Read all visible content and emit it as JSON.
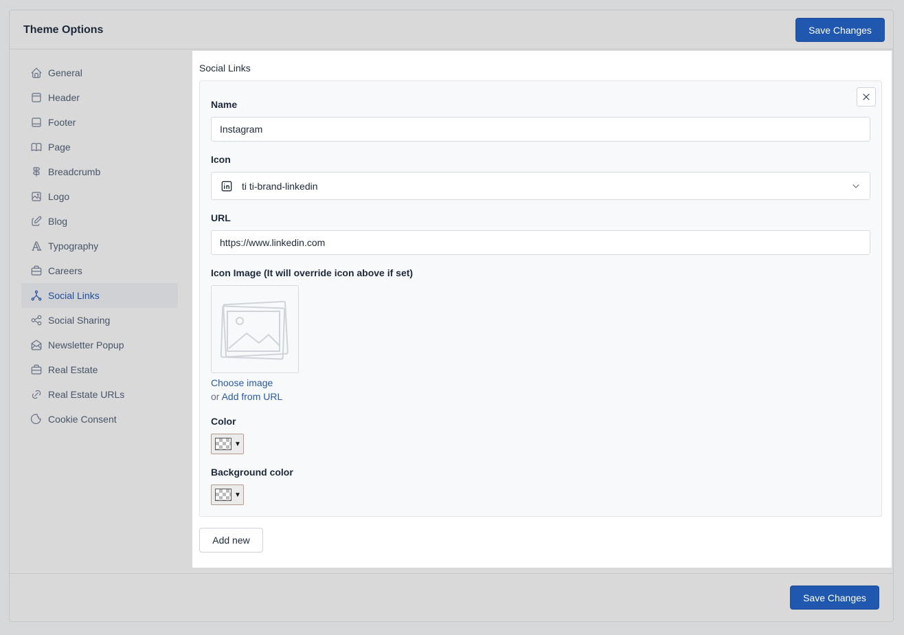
{
  "header": {
    "title": "Theme Options",
    "save_label": "Save Changes"
  },
  "footer": {
    "save_label": "Save Changes"
  },
  "sidebar": {
    "items": [
      {
        "label": "General",
        "icon": "home-icon"
      },
      {
        "label": "Header",
        "icon": "layout-header-icon"
      },
      {
        "label": "Footer",
        "icon": "layout-footer-icon"
      },
      {
        "label": "Page",
        "icon": "book-icon"
      },
      {
        "label": "Breadcrumb",
        "icon": "signpost-icon"
      },
      {
        "label": "Logo",
        "icon": "photo-icon"
      },
      {
        "label": "Blog",
        "icon": "edit-icon"
      },
      {
        "label": "Typography",
        "icon": "typography-icon"
      },
      {
        "label": "Careers",
        "icon": "briefcase-icon"
      },
      {
        "label": "Social Links",
        "icon": "social-icon",
        "active": true
      },
      {
        "label": "Social Sharing",
        "icon": "share-icon"
      },
      {
        "label": "Newsletter Popup",
        "icon": "mail-opened-icon"
      },
      {
        "label": "Real Estate",
        "icon": "briefcase-icon"
      },
      {
        "label": "Real Estate URLs",
        "icon": "link-icon"
      },
      {
        "label": "Cookie Consent",
        "icon": "cookie-icon"
      }
    ]
  },
  "main": {
    "section_title": "Social Links",
    "fields": {
      "name_label": "Name",
      "name_value": "Instagram",
      "icon_label": "Icon",
      "icon_value": "ti ti-brand-linkedin",
      "url_label": "URL",
      "url_value": "https://www.linkedin.com",
      "icon_image_label": "Icon Image (It will override icon above if set)",
      "choose_image": "Choose image",
      "or_text": "or",
      "add_from_url": "Add from URL",
      "color_label": "Color",
      "bg_color_label": "Background color"
    },
    "add_new_label": "Add new"
  },
  "colors": {
    "primary": "#2058b0",
    "active_text": "#1e4f9c",
    "link": "#2a5aa3"
  }
}
